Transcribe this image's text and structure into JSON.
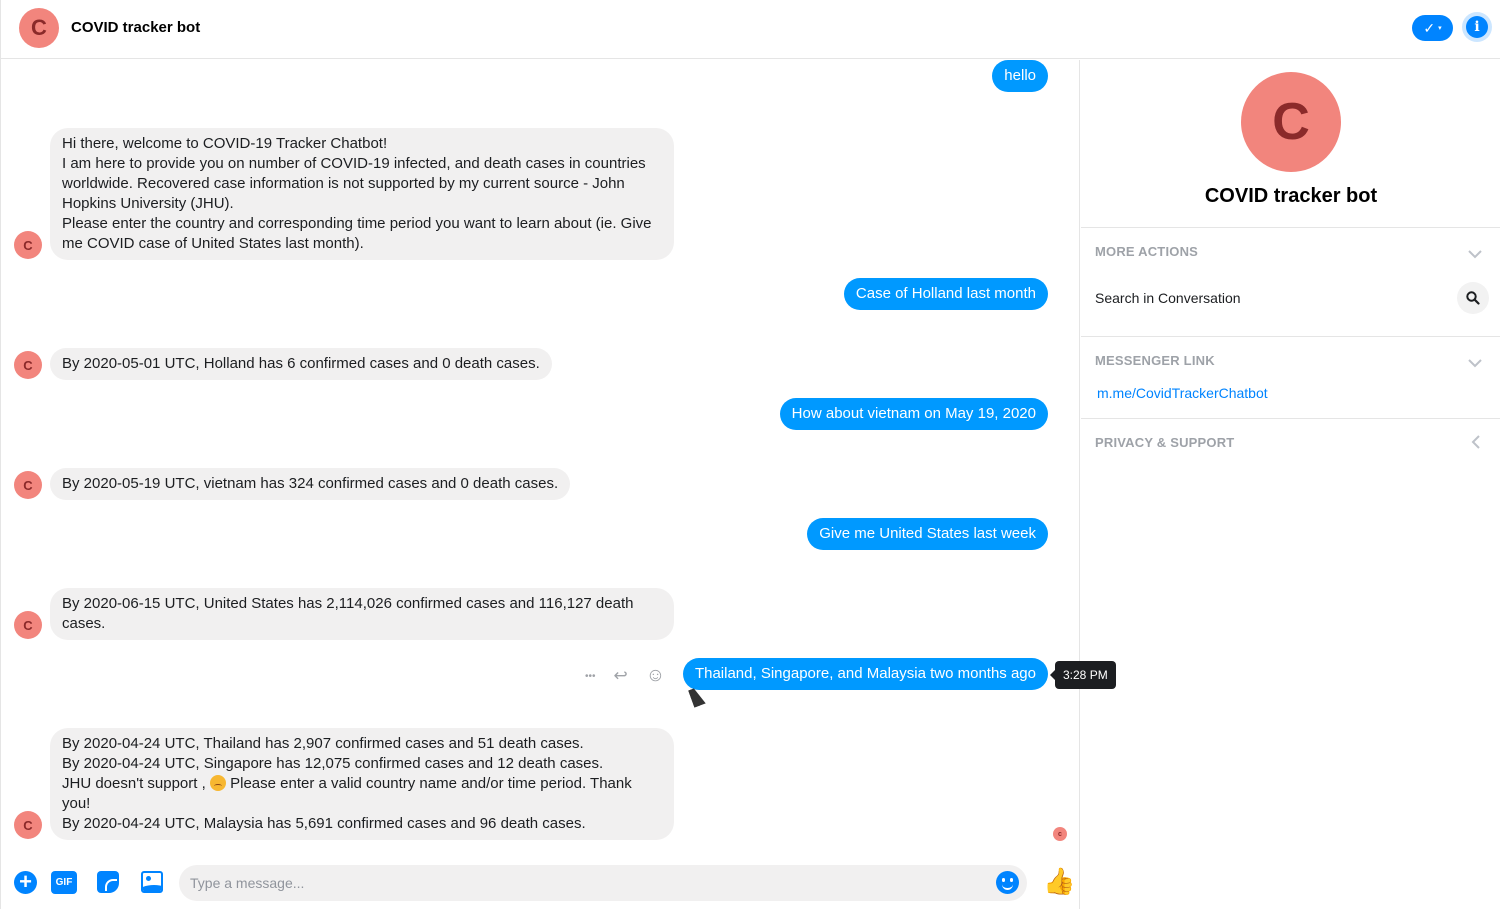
{
  "header": {
    "avatar_letter": "C",
    "title": "COVID tracker bot",
    "check_icon": "✓",
    "caret": "▾",
    "info_icon": "i"
  },
  "conversation": {
    "bot_avatar_letter": "C",
    "messages": [
      {
        "from": "user",
        "text": "hello"
      },
      {
        "from": "bot",
        "lines": [
          "Hi there, welcome to COVID-19 Tracker Chatbot!",
          "I am here to provide you on number of COVID-19 infected, and death cases in countries worldwide. Recovered case information is not supported by my current source - John Hopkins University (JHU).",
          "Please enter the country and corresponding time period you want to learn about (ie. Give me COVID case of United States last month)."
        ]
      },
      {
        "from": "user",
        "text": "Case of Holland last month"
      },
      {
        "from": "bot",
        "lines": [
          "By 2020-05-01 UTC, Holland has 6 confirmed cases and 0 death cases."
        ]
      },
      {
        "from": "user",
        "text": "How about vietnam on May 19, 2020"
      },
      {
        "from": "bot",
        "lines": [
          "By 2020-05-19 UTC, vietnam has 324 confirmed cases and 0 death cases."
        ]
      },
      {
        "from": "user",
        "text": "Give me United States last week"
      },
      {
        "from": "bot",
        "lines": [
          "By 2020-06-15 UTC, United States has 2,114,026 confirmed cases and 116,127 death cases."
        ]
      },
      {
        "from": "user",
        "text": "Thailand, Singapore, and Malaysia two months ago"
      },
      {
        "from": "bot",
        "lines": [
          "By 2020-04-24 UTC, Thailand has 2,907 confirmed cases and 51 death cases.",
          "By 2020-04-24 UTC, Singapore has 12,075 confirmed cases and 12 death cases.",
          "JHU doesn't support ,",
          "Please enter a valid country name and/or time period. Thank you!",
          "By 2020-04-24 UTC, Malaysia has 5,691 confirmed cases and 96 death cases."
        ]
      }
    ],
    "hover_tools": {
      "more": "•••",
      "reply": "↩",
      "react": "☺"
    },
    "tooltip_time": "3:28 PM",
    "seen_letter": "c"
  },
  "composer": {
    "plus": "+",
    "gif": "GIF",
    "placeholder": "Type a message...",
    "like": "👍"
  },
  "panel": {
    "avatar_letter": "C",
    "name": "COVID tracker bot",
    "more_actions": "MORE ACTIONS",
    "search_label": "Search in Conversation",
    "messenger_link_title": "MESSENGER LINK",
    "messenger_link": "m.me/CovidTrackerChatbot",
    "privacy_support": "PRIVACY & SUPPORT"
  }
}
